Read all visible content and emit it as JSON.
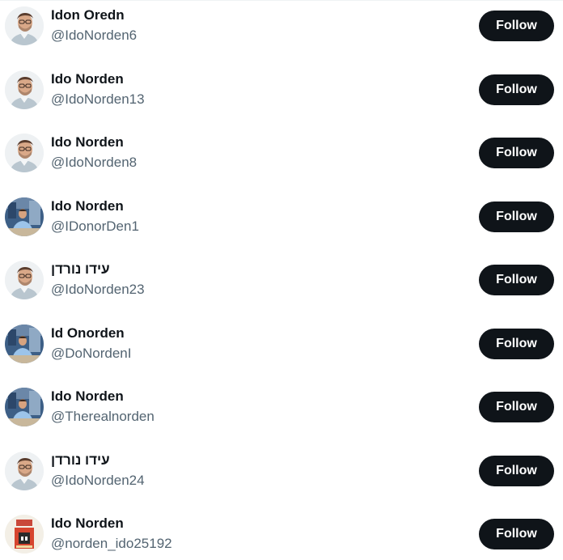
{
  "follow_label": "Follow",
  "users": [
    {
      "name": "Idon Oredn",
      "handle": "@IdoNorden6",
      "avatar": "portrait-glasses"
    },
    {
      "name": "Ido Norden",
      "handle": "@IdoNorden13",
      "avatar": "portrait-glasses"
    },
    {
      "name": "Ido Norden",
      "handle": "@IdoNorden8",
      "avatar": "portrait-glasses"
    },
    {
      "name": "Ido Norden",
      "handle": "@IDonorDen1",
      "avatar": "person-blue-shirt"
    },
    {
      "name": "עידו נורדן",
      "handle": "@IdoNorden23",
      "avatar": "portrait-glasses"
    },
    {
      "name": "Id Onorden",
      "handle": "@DoNordenI",
      "avatar": "person-blue-shirt"
    },
    {
      "name": "Ido Norden",
      "handle": "@Therealnorden",
      "avatar": "person-blue-shirt"
    },
    {
      "name": "עידו נורדן",
      "handle": "@IdoNorden24",
      "avatar": "portrait-glasses"
    },
    {
      "name": "Ido Norden",
      "handle": "@norden_ido25192",
      "avatar": "book-cover"
    }
  ],
  "colors": {
    "name": "#0f1419",
    "handle": "#536471",
    "button_bg": "#0f1419",
    "button_text": "#ffffff"
  }
}
